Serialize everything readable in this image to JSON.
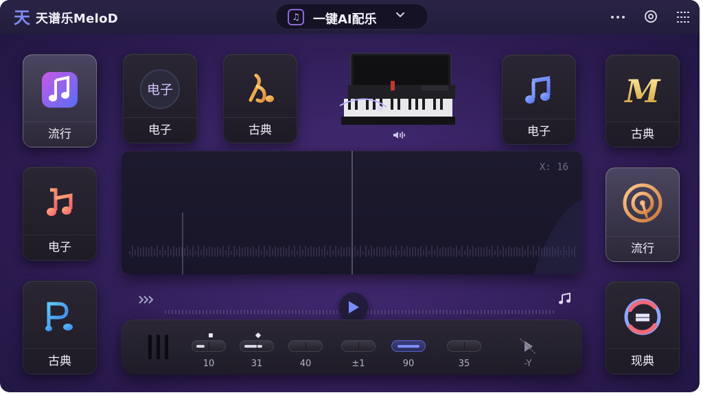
{
  "app": {
    "title": "天谱乐MeloD",
    "logo_text": "天"
  },
  "header": {
    "mode_label": "一键AI配乐",
    "mode_icon": "music-note-icon"
  },
  "top_icons": [
    "more-icon",
    "headphone-icon",
    "list-icon"
  ],
  "tiles_left": [
    {
      "label": "流行",
      "icon": "music-app-icon"
    },
    {
      "label": "电子",
      "icon": "double-note-icon"
    },
    {
      "label": "古典",
      "icon": "p-note-icon"
    }
  ],
  "tiles_top": [
    {
      "label": "电子",
      "icon": "electro-badge-icon",
      "badge_text": "电子"
    },
    {
      "label": "古典",
      "icon": "treble-clef-icon"
    }
  ],
  "tiles_top_right": [
    {
      "label": "电子",
      "icon": "beamed-note-icon"
    }
  ],
  "tiles_right": [
    {
      "label": "古典",
      "icon": "m-logo-icon",
      "logo_text": "M"
    },
    {
      "label": "流行",
      "icon": "pin-disc-icon"
    },
    {
      "label": "现典",
      "icon": "swirl-logo-icon"
    }
  ],
  "waveform": {
    "time": "X: 16"
  },
  "mixer": {
    "knobs": [
      {
        "value": "10"
      },
      {
        "value": "31"
      },
      {
        "value": "40"
      },
      {
        "value": "±1"
      },
      {
        "value": "90"
      },
      {
        "value": "35"
      }
    ],
    "end_value": "-Y"
  },
  "colors": {
    "accent": "#7f8cff",
    "background": "#3a2466",
    "panel": "#1d1a2e"
  }
}
